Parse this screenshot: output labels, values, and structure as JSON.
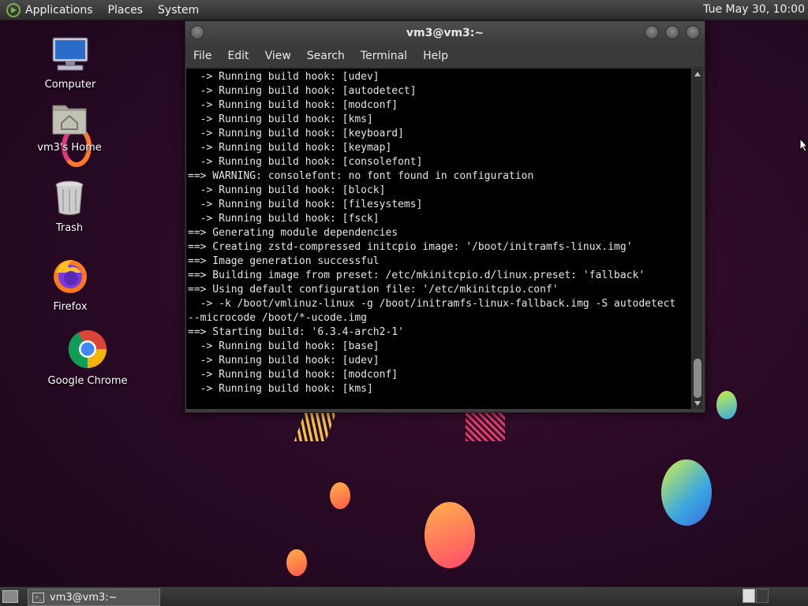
{
  "top_panel": {
    "menus": [
      "Applications",
      "Places",
      "System"
    ],
    "clock": "Tue May 30, 10:00"
  },
  "desktop_icons": {
    "computer": "Computer",
    "home": "vm3's Home",
    "trash": "Trash",
    "firefox": "Firefox",
    "chrome": "Google Chrome"
  },
  "terminal": {
    "title": "vm3@vm3:~",
    "menu": [
      "File",
      "Edit",
      "View",
      "Search",
      "Terminal",
      "Help"
    ],
    "lines": [
      "  -> Running build hook: [udev]",
      "  -> Running build hook: [autodetect]",
      "  -> Running build hook: [modconf]",
      "  -> Running build hook: [kms]",
      "  -> Running build hook: [keyboard]",
      "  -> Running build hook: [keymap]",
      "  -> Running build hook: [consolefont]",
      "==> WARNING: consolefont: no font found in configuration",
      "  -> Running build hook: [block]",
      "  -> Running build hook: [filesystems]",
      "  -> Running build hook: [fsck]",
      "==> Generating module dependencies",
      "==> Creating zstd-compressed initcpio image: '/boot/initramfs-linux.img'",
      "==> Image generation successful",
      "==> Building image from preset: /etc/mkinitcpio.d/linux.preset: 'fallback'",
      "==> Using default configuration file: '/etc/mkinitcpio.conf'",
      "  -> -k /boot/vmlinuz-linux -g /boot/initramfs-linux-fallback.img -S autodetect",
      "--microcode /boot/*-ucode.img",
      "==> Starting build: '6.3.4-arch2-1'",
      "  -> Running build hook: [base]",
      "  -> Running build hook: [udev]",
      "  -> Running build hook: [modconf]",
      "  -> Running build hook: [kms]"
    ]
  },
  "taskbar": {
    "task_label": "vm3@vm3:~"
  },
  "colors": {
    "accent_green": "#7cae4a",
    "terminal_bg": "#000000",
    "terminal_fg": "#e6e6e6"
  }
}
